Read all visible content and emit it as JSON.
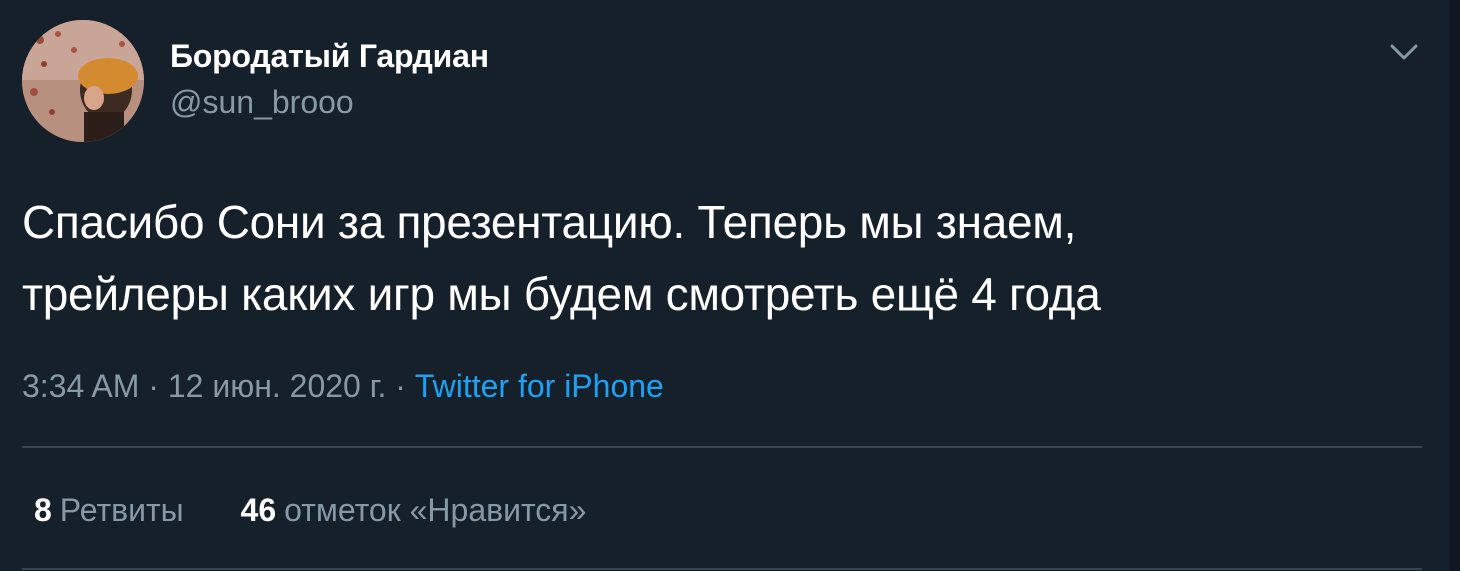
{
  "tweet": {
    "author": {
      "display_name": "Бородатый Гардиан",
      "username": "@sun_brooo",
      "avatar_icon": "user-avatar-photo"
    },
    "menu_icon": "chevron-down-icon",
    "text_line_1": "Спасибо Сони за презентацию. Теперь мы знаем,",
    "text_line_2": "трейлеры каких игр мы будем смотреть ещё 4 года",
    "meta": {
      "time": "3:34 AM",
      "separator": " · ",
      "date": "12 июн. 2020 г.",
      "source": "Twitter for iPhone"
    },
    "stats": {
      "retweets_count": "8",
      "retweets_label": "Ретвиты",
      "likes_count": "46",
      "likes_label": "отметок «Нравится»"
    }
  },
  "colors": {
    "background": "#15202b",
    "text_primary": "#ffffff",
    "text_secondary": "#8899a6",
    "link": "#1da1f2",
    "divider": "#38444d"
  }
}
